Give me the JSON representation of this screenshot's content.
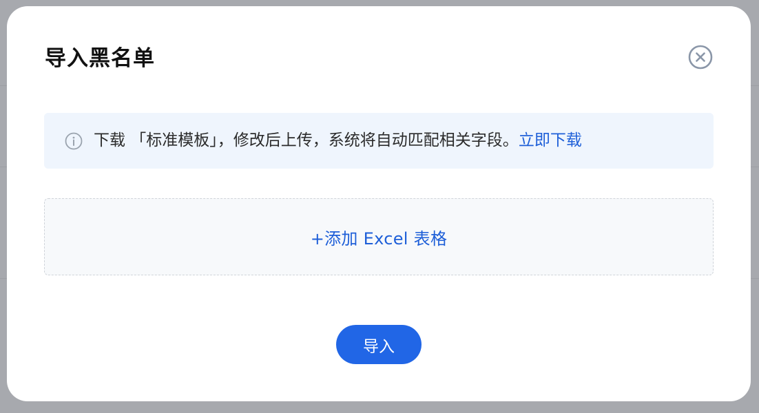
{
  "dialog": {
    "title": "导入黑名单",
    "notice": {
      "text": "下载 「标准模板」，修改后上传，系统将自动匹配相关字段。",
      "link_label": "立即下载"
    },
    "upload": {
      "label": "+添加 Excel 表格"
    },
    "submit_label": "导入"
  },
  "icons": {
    "close": "close-circle-icon",
    "info": "info-circle-icon"
  },
  "colors": {
    "accent": "#2166e6",
    "link": "#1e5fd8",
    "notice_bg": "#eff5fd",
    "overlay": "#a7a9ae"
  }
}
